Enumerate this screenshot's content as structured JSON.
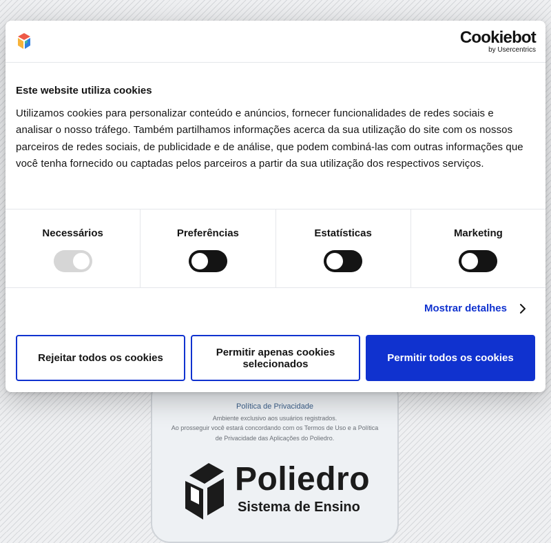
{
  "background": {
    "privacy_link": "Política de Privacidade",
    "note_line_1": "Ambiente exclusivo aos usuários registrados.",
    "note_line_2": "Ao prosseguir você estará concordando com os Termos de Uso e a Política",
    "note_line_3": "de Privacidade das Aplicações do Poliedro.",
    "brand_name": "Poliedro",
    "brand_subtitle": "Sistema de Ensino"
  },
  "dialog": {
    "header": {
      "logo_icon": "cookiebot-cube-icon",
      "wordmark_name": "Cookiebot",
      "wordmark_by": "by Usercentrics"
    },
    "title": "Este website utiliza cookies",
    "body": "Utilizamos cookies para personalizar conteúdo e anúncios, fornecer funcionalidades de redes sociais e analisar o nosso tráfego. Também partilhamos informações acerca da sua utilização do site com os nossos parceiros de redes sociais, de publicidade e de análise, que podem combiná-las com outras informações que você tenha fornecido ou captadas pelos parceiros a partir da sua utilização dos respectivos serviços.",
    "categories": [
      {
        "label": "Necessários",
        "enabled": true,
        "locked": true
      },
      {
        "label": "Preferências",
        "enabled": false,
        "locked": false
      },
      {
        "label": "Estatísticas",
        "enabled": false,
        "locked": false
      },
      {
        "label": "Marketing",
        "enabled": false,
        "locked": false
      }
    ],
    "details_link": "Mostrar detalhes",
    "buttons": {
      "reject_all": "Rejeitar todos os cookies",
      "allow_selected": "Permitir apenas cookies selecionados",
      "allow_all": "Permitir todos os cookies"
    },
    "colors": {
      "accent": "#1032cf",
      "toggle_off": "#141414",
      "toggle_locked": "#d6d6d6"
    }
  }
}
